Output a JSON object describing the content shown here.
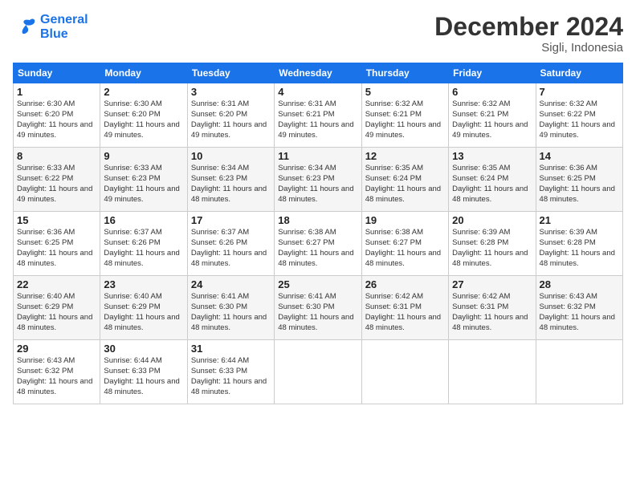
{
  "logo": {
    "line1": "General",
    "line2": "Blue"
  },
  "title": "December 2024",
  "subtitle": "Sigli, Indonesia",
  "days_header": [
    "Sunday",
    "Monday",
    "Tuesday",
    "Wednesday",
    "Thursday",
    "Friday",
    "Saturday"
  ],
  "weeks": [
    [
      {
        "day": "1",
        "sunrise": "6:30 AM",
        "sunset": "6:20 PM",
        "daylight": "11 hours and 49 minutes."
      },
      {
        "day": "2",
        "sunrise": "6:30 AM",
        "sunset": "6:20 PM",
        "daylight": "11 hours and 49 minutes."
      },
      {
        "day": "3",
        "sunrise": "6:31 AM",
        "sunset": "6:20 PM",
        "daylight": "11 hours and 49 minutes."
      },
      {
        "day": "4",
        "sunrise": "6:31 AM",
        "sunset": "6:21 PM",
        "daylight": "11 hours and 49 minutes."
      },
      {
        "day": "5",
        "sunrise": "6:32 AM",
        "sunset": "6:21 PM",
        "daylight": "11 hours and 49 minutes."
      },
      {
        "day": "6",
        "sunrise": "6:32 AM",
        "sunset": "6:21 PM",
        "daylight": "11 hours and 49 minutes."
      },
      {
        "day": "7",
        "sunrise": "6:32 AM",
        "sunset": "6:22 PM",
        "daylight": "11 hours and 49 minutes."
      }
    ],
    [
      {
        "day": "8",
        "sunrise": "6:33 AM",
        "sunset": "6:22 PM",
        "daylight": "11 hours and 49 minutes."
      },
      {
        "day": "9",
        "sunrise": "6:33 AM",
        "sunset": "6:23 PM",
        "daylight": "11 hours and 49 minutes."
      },
      {
        "day": "10",
        "sunrise": "6:34 AM",
        "sunset": "6:23 PM",
        "daylight": "11 hours and 48 minutes."
      },
      {
        "day": "11",
        "sunrise": "6:34 AM",
        "sunset": "6:23 PM",
        "daylight": "11 hours and 48 minutes."
      },
      {
        "day": "12",
        "sunrise": "6:35 AM",
        "sunset": "6:24 PM",
        "daylight": "11 hours and 48 minutes."
      },
      {
        "day": "13",
        "sunrise": "6:35 AM",
        "sunset": "6:24 PM",
        "daylight": "11 hours and 48 minutes."
      },
      {
        "day": "14",
        "sunrise": "6:36 AM",
        "sunset": "6:25 PM",
        "daylight": "11 hours and 48 minutes."
      }
    ],
    [
      {
        "day": "15",
        "sunrise": "6:36 AM",
        "sunset": "6:25 PM",
        "daylight": "11 hours and 48 minutes."
      },
      {
        "day": "16",
        "sunrise": "6:37 AM",
        "sunset": "6:26 PM",
        "daylight": "11 hours and 48 minutes."
      },
      {
        "day": "17",
        "sunrise": "6:37 AM",
        "sunset": "6:26 PM",
        "daylight": "11 hours and 48 minutes."
      },
      {
        "day": "18",
        "sunrise": "6:38 AM",
        "sunset": "6:27 PM",
        "daylight": "11 hours and 48 minutes."
      },
      {
        "day": "19",
        "sunrise": "6:38 AM",
        "sunset": "6:27 PM",
        "daylight": "11 hours and 48 minutes."
      },
      {
        "day": "20",
        "sunrise": "6:39 AM",
        "sunset": "6:28 PM",
        "daylight": "11 hours and 48 minutes."
      },
      {
        "day": "21",
        "sunrise": "6:39 AM",
        "sunset": "6:28 PM",
        "daylight": "11 hours and 48 minutes."
      }
    ],
    [
      {
        "day": "22",
        "sunrise": "6:40 AM",
        "sunset": "6:29 PM",
        "daylight": "11 hours and 48 minutes."
      },
      {
        "day": "23",
        "sunrise": "6:40 AM",
        "sunset": "6:29 PM",
        "daylight": "11 hours and 48 minutes."
      },
      {
        "day": "24",
        "sunrise": "6:41 AM",
        "sunset": "6:30 PM",
        "daylight": "11 hours and 48 minutes."
      },
      {
        "day": "25",
        "sunrise": "6:41 AM",
        "sunset": "6:30 PM",
        "daylight": "11 hours and 48 minutes."
      },
      {
        "day": "26",
        "sunrise": "6:42 AM",
        "sunset": "6:31 PM",
        "daylight": "11 hours and 48 minutes."
      },
      {
        "day": "27",
        "sunrise": "6:42 AM",
        "sunset": "6:31 PM",
        "daylight": "11 hours and 48 minutes."
      },
      {
        "day": "28",
        "sunrise": "6:43 AM",
        "sunset": "6:32 PM",
        "daylight": "11 hours and 48 minutes."
      }
    ],
    [
      {
        "day": "29",
        "sunrise": "6:43 AM",
        "sunset": "6:32 PM",
        "daylight": "11 hours and 48 minutes."
      },
      {
        "day": "30",
        "sunrise": "6:44 AM",
        "sunset": "6:33 PM",
        "daylight": "11 hours and 48 minutes."
      },
      {
        "day": "31",
        "sunrise": "6:44 AM",
        "sunset": "6:33 PM",
        "daylight": "11 hours and 48 minutes."
      },
      null,
      null,
      null,
      null
    ]
  ]
}
